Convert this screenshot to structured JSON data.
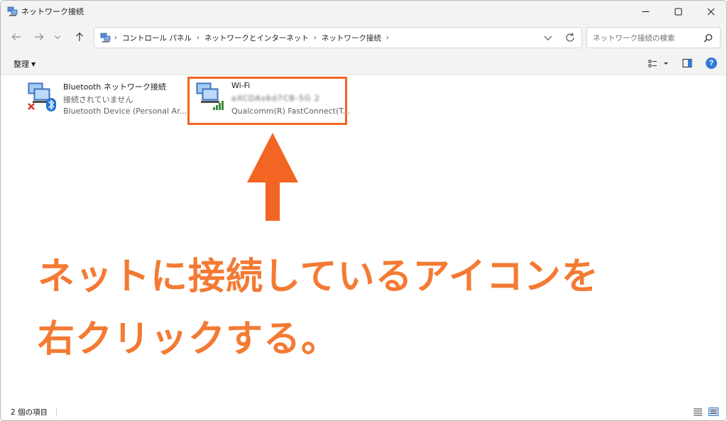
{
  "window": {
    "title": "ネットワーク接続",
    "minimize_icon": "minimize-icon",
    "maximize_icon": "maximize-icon",
    "close_icon": "close-icon"
  },
  "navigation": {
    "breadcrumbs": [
      "コントロール パネル",
      "ネットワークとインターネット",
      "ネットワーク接続"
    ],
    "search_placeholder": "ネットワーク接続の検索"
  },
  "toolbar": {
    "organize_label": "整理"
  },
  "connections": [
    {
      "name": "Bluetooth ネットワーク接続",
      "status": "接続されていません",
      "device": "Bluetooth Device (Personal Ar...",
      "icon": "network-disconnected-bluetooth-icon"
    },
    {
      "name": "Wi-Fi",
      "status": "aXCDAs6d7CB-5G 2",
      "device": "Qualcomm(R) FastConnect(T...",
      "icon": "network-wifi-icon"
    }
  ],
  "annotation": {
    "line1": "ネットに接続しているアイコンを",
    "line2": "右クリックする。",
    "color": "#f47a33"
  },
  "statusbar": {
    "item_count": "2 個の項目"
  },
  "colors": {
    "highlight": "#f26522",
    "chrome": "#f3f3f3",
    "accent": "#2f7bd6"
  }
}
